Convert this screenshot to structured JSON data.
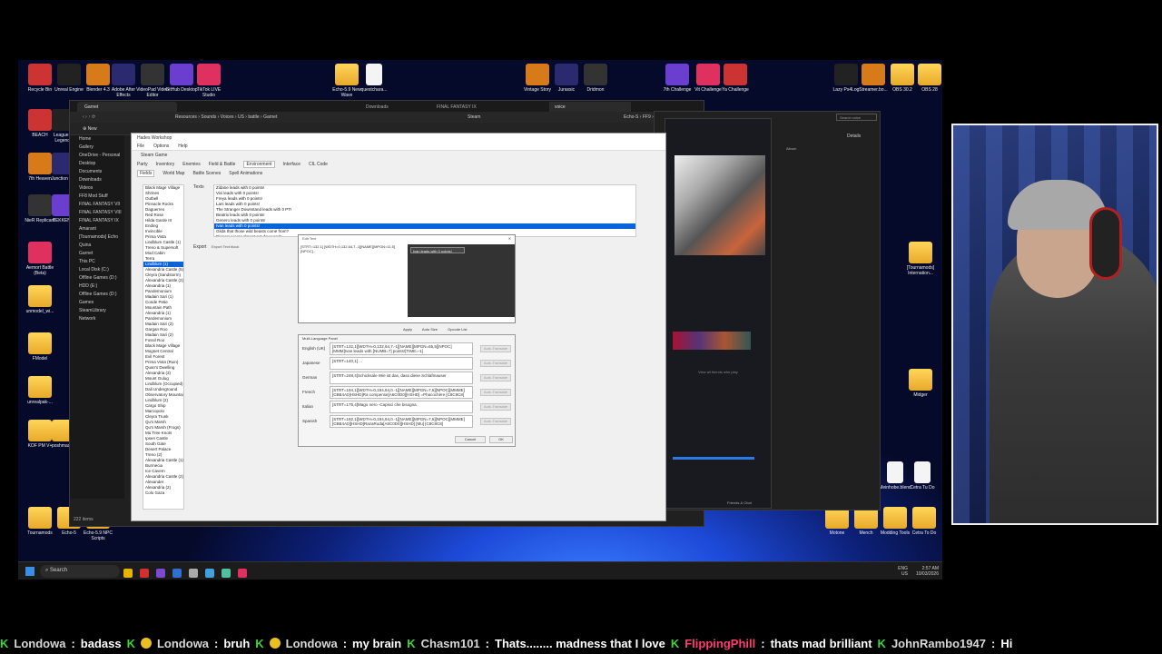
{
  "desktop_icons_top": [
    "Recycle Bin",
    "Unreal Engine",
    "Blender 4.3",
    "Adobe After Effects",
    "VideoPad Video Editor",
    "GitHub Desktop",
    "TikTok LIVE Studio",
    "Echo-5.9 New Wave",
    "questchara...",
    "Vintage Story",
    "Jurassic",
    "Dridmon",
    "7th Challenge",
    "Vit Challenge",
    "Ya Challenge",
    "Lazy Ps4Log",
    "Streamer.bo...",
    "OBS 30.2",
    "OBS 28"
  ],
  "desktop_icons_left": [
    "BEACH",
    "League of Legends",
    "7th Heaven",
    "Junction VIII",
    "NieR Replicant",
    "TEKKEN 8",
    "Aemort Battle (Beta)",
    "unmodel_wi...",
    "FModel",
    "unrealpak-...",
    "KOF PM V+",
    "poshmaster",
    "Tournamods",
    "Echo-5",
    "Echo-5.9 NPC Scripts"
  ],
  "desktop_icons_right": [
    "[Tournamods] Internation...",
    "Midger",
    "Meinhobe.blend",
    "Cetra Tu Do",
    "Motone",
    "Mench",
    "Modding Tools",
    "Cetra To Do"
  ],
  "explorer": {
    "tab_title": "Garnet",
    "tab2": "Downloads",
    "tab3": "FINAL FANTASY IX",
    "tab4": "voice",
    "breadcrumb": [
      "Resources",
      "Sounds",
      "Voices",
      "US",
      "battle",
      "Garnet"
    ],
    "breadcrumb2": [
      "Steam"
    ],
    "breadcrumb3": [
      "Echo-S",
      "FF9",
      "voice"
    ],
    "search_placeholder": "Search voice",
    "new_label": "New",
    "sidebar": [
      "Home",
      "Gallery",
      "OneDrive - Personal",
      "Desktop",
      "Documents",
      "Downloads",
      "Videos",
      "FF8 Mod Stuff",
      "FINAL FANTASY VII",
      "FINAL FANTASY VIII",
      "FINAL FANTASY IX",
      "Amarant",
      "[Tournamods] Echo",
      "Quina",
      "Garnet",
      "This PC",
      "Local Disk (C:)",
      "Offline Games (D:)",
      "HDD (E:)",
      "Offline Games (D:)",
      "Games",
      "SteamLibrary",
      "Network"
    ],
    "item_count": "222 items",
    "details_label": "Details",
    "album_label": "Album"
  },
  "hw": {
    "title": "Hades Workshop",
    "menu": [
      "File",
      "Options",
      "Help"
    ],
    "toolbar": [
      "Steam Game"
    ],
    "tabs_row1": [
      "Party",
      "Inventory",
      "Enemies",
      "Field & Battle",
      "Environment",
      "Interface",
      "CIL Code"
    ],
    "tabs_row2": [
      "Fields",
      "World Map",
      "Battle Scenes",
      "Spell Animations"
    ],
    "left_nav": [
      "Texts",
      "Export"
    ],
    "export_label": "Export Text block"
  },
  "fields": [
    "Black Mage Village",
    "Shrines",
    "Outbell",
    "Pinnacle Rocks",
    "Daguerreo",
    "Red Rose",
    "Hilda Garde III",
    "Ending",
    "Invincible",
    "Prima Vista",
    "Lindblum Castle (1)",
    "Treno & Supersoft",
    "Mod Cabin",
    "Terra",
    "Lindblum (1)",
    "Alexandria Castle (5)",
    "Cleyra (Sandstorm)",
    "Alexandria Castle (2)",
    "Alexandria (1)",
    "Pandemonium",
    "Madain Sari (1)",
    "Conde Petie",
    "Mountain Path",
    "Alexandria (1)",
    "Pandemonium",
    "Madain Sari (2)",
    "Gargan Roo",
    "Madain Sari (2)",
    "Fossil Roo",
    "Black Mage Village",
    "Mognet Central",
    "Evil Forest",
    "Prima Vista (Ruin)",
    "Quan's Dwelling",
    "Alexandria (3)",
    "Mount Gulug",
    "Lindblum (Occupied)",
    "Dali Underground",
    "Observatory Mountain",
    "Lindblum (2)",
    "Cargo Ship",
    "Marcopolo",
    "Cleyra Trunk",
    "Qu's Marsh",
    "Qu's Marsh (Frogs)",
    "Mu Tree Knots",
    "Ipsen Castle",
    "South Gate",
    "Desert Palace",
    "Treno (2)",
    "Alexandria Castle (1)",
    "Burmecia",
    "Ice Cavern",
    "Alexandria Castle (2)",
    "Alexander",
    "Alexandria (2)",
    "Colo Gaza"
  ],
  "texts": [
    "Zidane leads with 0 points!",
    "Vivi leads with 0 points!",
    "Freya leads with 0 points!",
    "Lani leads with 0 points!",
    "The Stranger Downstand leads with 0 PT!",
    "Beatrix leads with 0 points!",
    "Genero leads with 0 points!",
    "Ivan leads with 0 points!",
    "Gilda that those wild beasts come from?",
    "Pigeon: Lies! I almost got devoured!"
  ],
  "edit_text": {
    "title": "Edit Text",
    "formatted": "[STRT=132,1] [WDTH=0,132,64,7.-1][NAME][MPGN=11,5][NPOC]...",
    "preview": "Ivan leads with 0 points!",
    "apply": "Apply",
    "auto_size": "Auto Size",
    "opcode_list": "Opcode List"
  },
  "multi_lang": {
    "title": "Multi-Language Panel",
    "auto_translate": "Auto-Translate",
    "rows": [
      {
        "lang": "English (UK)",
        "text": "[STRT=132,1][WDTH=0,132,64,7.-1][NAME][MPGN=65,5][NPOC] [MMM]Ivan leads with [NUMB=7] points![TIME=-1]"
      },
      {
        "lang": "Japanese",
        "text": "[STRT=140,1] ..."
      },
      {
        "lang": "German",
        "text": "[STRT=248,4]Schicksale Wie ist das, dass diese Schlafmauser"
      },
      {
        "lang": "French",
        "text": "[STRT=194,1][WDTH=0,194,64,0.-1][NAME][MPGN=7,5][NPOC][MMME] [CBB4A0]HSHD]Ra compense[A6C0D0][HSHD] =Phacochère [C8C8C8]"
      },
      {
        "lang": "Italian",
        "text": "[STRT=175,4]Mago nero -Capisci che bisogna"
      },
      {
        "lang": "Spanish",
        "text": "[STRT=192,1][WDTH=0,194,64,0.-1][NAME][MPGN=7,5][NPOC][MMME] [CBB4A0][HSHD]RazaRoda[A6C0D0][HSHD] [Mu] [C8C8C8]"
      }
    ],
    "cancel": "Cancel",
    "ok": "OK"
  },
  "steam": {
    "friends_label": "Friends & Chat",
    "view_all": "View all friends who play"
  },
  "taskbar": {
    "search": "Search",
    "time": "2:57 AM",
    "date": "10/03/2026",
    "lang": "ENG",
    "region": "US"
  },
  "ticker": [
    {
      "name": "Londowa",
      "msg": "badass",
      "color": "#d8d8d8"
    },
    {
      "name": "Londowa",
      "msg": "bruh",
      "color": "#d8d8d8"
    },
    {
      "name": "Londowa",
      "msg": "my brain",
      "color": "#d8d8d8"
    },
    {
      "name": "Chasm101",
      "msg": "Thats........ madness that I love",
      "color": "#d8d8d8"
    },
    {
      "name": "FlippingPhill",
      "msg": "thats mad brilliant",
      "color": "#ff3d6e"
    },
    {
      "name": "JohnRambo1947",
      "msg": "Hi",
      "color": "#d8d8d8"
    }
  ]
}
